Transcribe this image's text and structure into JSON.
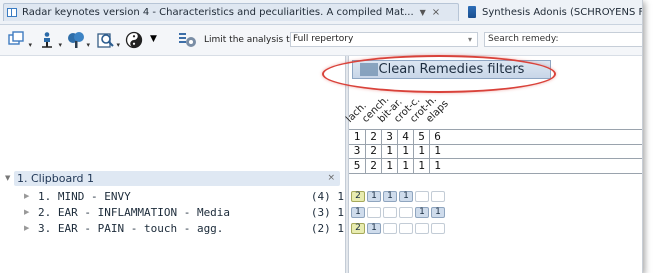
{
  "tabs": [
    {
      "label": "Radar keynotes version 4 - Characteristics and peculiarities. A compiled Mat...",
      "dropdown": "▼",
      "close": "×",
      "active": true
    },
    {
      "label": "Synthesis Adonis (SCHROYENS F. )",
      "active": false
    }
  ],
  "toolbar": {
    "icons": [
      "window-split-icon",
      "pin-person-icon",
      "tree-icon",
      "repertory-search-icon",
      "yin-yang-icon"
    ],
    "limit_label": "Limit the analysis to a view:",
    "view_value": "Full repertory",
    "search_placeholder": "Search remedy:"
  },
  "clipboard": {
    "title": "1. Clipboard 1",
    "close": "×",
    "rubrics": [
      {
        "name": "1. MIND - ENVY",
        "count": "(4) 1"
      },
      {
        "name": "2. EAR - INFLAMMATION - Media",
        "count": "(3) 1"
      },
      {
        "name": "3. EAR - PAIN - touch - agg.",
        "count": "(2) 1"
      }
    ]
  },
  "analysis": {
    "clean_button": "Clean Remedies filters",
    "remedies": [
      "lach.",
      "cench.",
      "bit-ar.",
      "crot-c.",
      "crot-h.",
      "elaps"
    ],
    "grid_rows": [
      [
        "1",
        "2",
        "3",
        "4",
        "5",
        "6"
      ],
      [
        "3",
        "2",
        "1",
        "1",
        "1",
        "1"
      ],
      [
        "5",
        "2",
        "1",
        "1",
        "1",
        "1"
      ]
    ],
    "grades": [
      [
        "2",
        "1",
        "1",
        "1",
        "",
        ""
      ],
      [
        "1",
        "",
        "",
        "",
        "1",
        "1"
      ],
      [
        "2",
        "1",
        "",
        "",
        "",
        ""
      ]
    ]
  },
  "colors": {
    "highlight_ellipse": "#d9423a",
    "grade2": "#e8ecb0",
    "grade1": "#cfdcec"
  }
}
